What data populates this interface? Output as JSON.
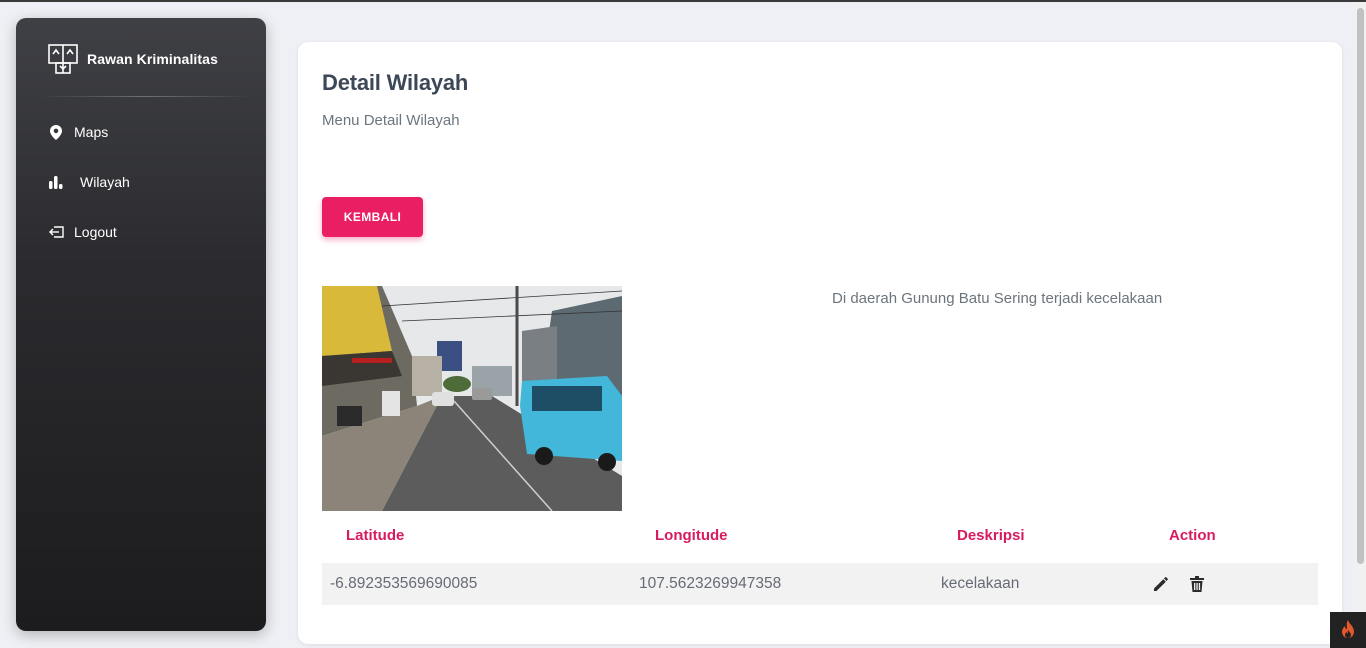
{
  "sidebar": {
    "brand": "Rawan Kriminalitas",
    "items": [
      {
        "label": "Maps",
        "icon": "map-pin-icon"
      },
      {
        "label": "Wilayah",
        "icon": "bar-chart-icon"
      },
      {
        "label": "Logout",
        "icon": "logout-icon"
      }
    ]
  },
  "main": {
    "title": "Detail Wilayah",
    "subtitle": "Menu Detail Wilayah",
    "back_button": "KEMBALI",
    "description": "Di daerah Gunung Batu Sering terjadi kecelakaan",
    "photo": {
      "icon": "street-photo"
    },
    "table": {
      "headers": [
        "Latitude",
        "Longitude",
        "Deskripsi",
        "Action"
      ],
      "rows": [
        {
          "latitude": "-6.892353569690085",
          "longitude": "107.5623269947358",
          "deskripsi": "kecelakaan",
          "actions": [
            "edit-icon",
            "trash-icon"
          ]
        }
      ]
    }
  },
  "colors": {
    "accent": "#e91e63",
    "sidebar_top": "#3f4045",
    "sidebar_bottom": "#1c1c1e",
    "title": "#3c4858",
    "background": "#eef0f5"
  }
}
